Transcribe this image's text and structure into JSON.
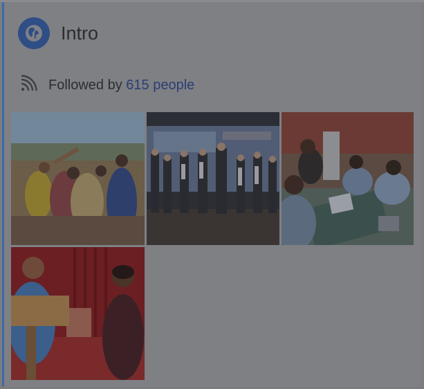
{
  "intro": {
    "title": "Intro",
    "followed_prefix": "Followed by",
    "followed_link": "615 people"
  },
  "photos": [
    {
      "alt": "Group of students posing outdoors"
    },
    {
      "alt": "Group standing on a stage"
    },
    {
      "alt": "People working on laptops at a table"
    },
    {
      "alt": "Speaker at a podium with a woman on stage"
    }
  ],
  "colors": {
    "accent": "#3b6aa8",
    "globe": "#2f4e86",
    "link": "#2b3e74"
  },
  "icons": {
    "header": "globe-icon",
    "followed": "rss-icon"
  }
}
